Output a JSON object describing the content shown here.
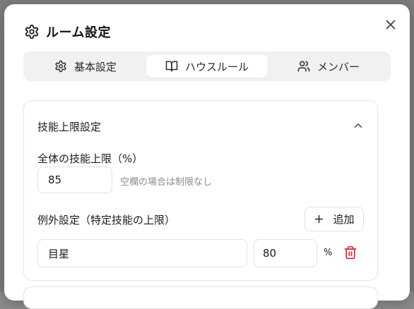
{
  "dialog": {
    "title": "ルーム設定",
    "title_icon": "gear-icon",
    "close_icon": "close-icon"
  },
  "tabs": [
    {
      "label": "基本設定",
      "icon": "gear-icon",
      "active": false
    },
    {
      "label": "ハウスルール",
      "icon": "book-open-icon",
      "active": true
    },
    {
      "label": "メンバー",
      "icon": "users-icon",
      "active": false
    }
  ],
  "skill_limit_section": {
    "title": "技能上限設定",
    "toggle_icon": "chevron-up-icon",
    "overall_label": "全体の技能上限（%）",
    "overall_value": "85",
    "overall_hint": "空欄の場合は制限なし",
    "exceptions_label": "例外設定（特定技能の上限）",
    "add_button_label": "追加",
    "exceptions": [
      {
        "skill": "目星",
        "limit": "80",
        "unit": "%"
      }
    ]
  },
  "colors": {
    "accent_danger": "#e0242b",
    "tab_bar_bg": "#f1f1f0",
    "border": "#e2e2e0",
    "hint_text": "#8a8a8a"
  }
}
